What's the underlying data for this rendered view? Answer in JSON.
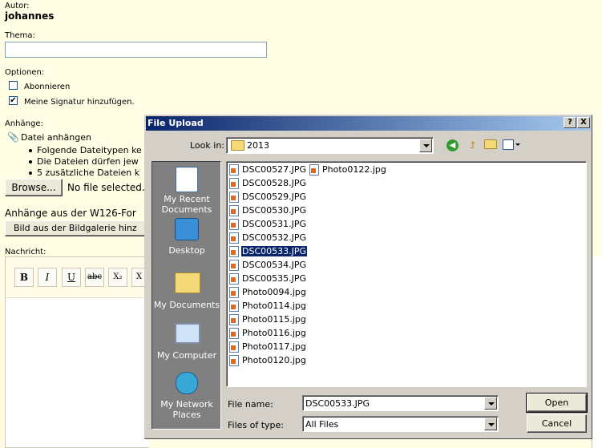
{
  "form": {
    "author_label": "Autor:",
    "author_value": "johannes",
    "topic_label": "Thema:",
    "topic_value": "",
    "options_label": "Optionen:",
    "subscribe_label": "Abonnieren",
    "signature_label": "Meine Signatur hinzufügen.",
    "subscribe_checked": false,
    "signature_checked": true,
    "attachments_label": "Anhänge:",
    "attach_file_label": "Datei anhängen",
    "bullets": [
      "Folgende Dateitypen ke",
      "Die Dateien dürfen jew",
      "5 zusätzliche Dateien k"
    ],
    "browse_label": "Browse...",
    "no_file_label": "No file selected.",
    "w126_label": "Anhänge aus der W126-For",
    "gallery_button": "Bild aus der Bildgalerie hinz",
    "message_label": "Nachricht:",
    "toolbar": {
      "bold": "B",
      "italic": "I",
      "underline": "U",
      "strike": "abc",
      "subscript": "X₂",
      "more": "X"
    }
  },
  "dialog": {
    "title": "File Upload",
    "help_btn": "?",
    "close_btn": "X",
    "look_in_label": "Look in:",
    "look_in_value": "2013",
    "places": [
      "My Recent Documents",
      "Desktop",
      "My Documents",
      "My Computer",
      "My Network Places"
    ],
    "files_col1": [
      "DSC00527.JPG",
      "DSC00528.JPG",
      "DSC00529.JPG",
      "DSC00530.JPG",
      "DSC00531.JPG",
      "DSC00532.JPG",
      "DSC00533.JPG",
      "DSC00534.JPG",
      "DSC00535.JPG",
      "Photo0094.jpg",
      "Photo0114.jpg",
      "Photo0115.jpg",
      "Photo0116.jpg",
      "Photo0117.jpg",
      "Photo0120.jpg"
    ],
    "files_col2": [
      "Photo0122.jpg"
    ],
    "selected_file": "DSC00533.JPG",
    "file_name_label": "File name:",
    "file_name_value": "DSC00533.JPG",
    "file_type_label": "Files of type:",
    "file_type_value": "All Files",
    "open_btn": "Open",
    "cancel_btn": "Cancel"
  }
}
